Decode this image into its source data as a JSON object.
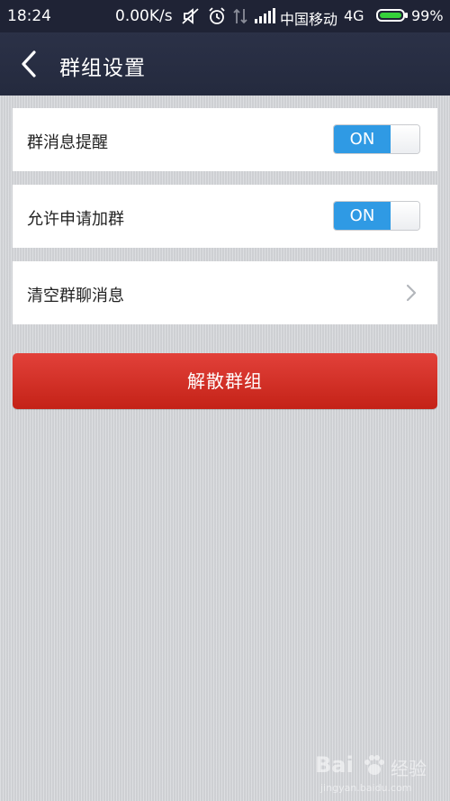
{
  "status_bar": {
    "time": "18:24",
    "net_speed": "0.00K/s",
    "carrier": "中国移动",
    "network_type": "4G",
    "battery_percent": "99%",
    "battery_level": 0.99,
    "icons": [
      "mute-icon",
      "alarm-icon",
      "data-transfer-icon",
      "signal-icon"
    ]
  },
  "header": {
    "title": "群组设置",
    "back_icon": "chevron-left-icon"
  },
  "settings": {
    "group_notify": {
      "label": "群消息提醒",
      "toggle": "ON"
    },
    "allow_join": {
      "label": "允许申请加群",
      "toggle": "ON"
    },
    "clear_messages": {
      "label": "清空群聊消息",
      "icon": "chevron-right-icon"
    }
  },
  "dissolve_button": {
    "label": "解散群组"
  },
  "watermark": {
    "logo": "Bai",
    "brand": "经验",
    "site": "jingyan.baidu.com"
  },
  "colors": {
    "header_bg": "#242a3e",
    "toggle_on": "#2f9ae4",
    "danger_button": "#d23128",
    "battery": "#35d13a"
  }
}
